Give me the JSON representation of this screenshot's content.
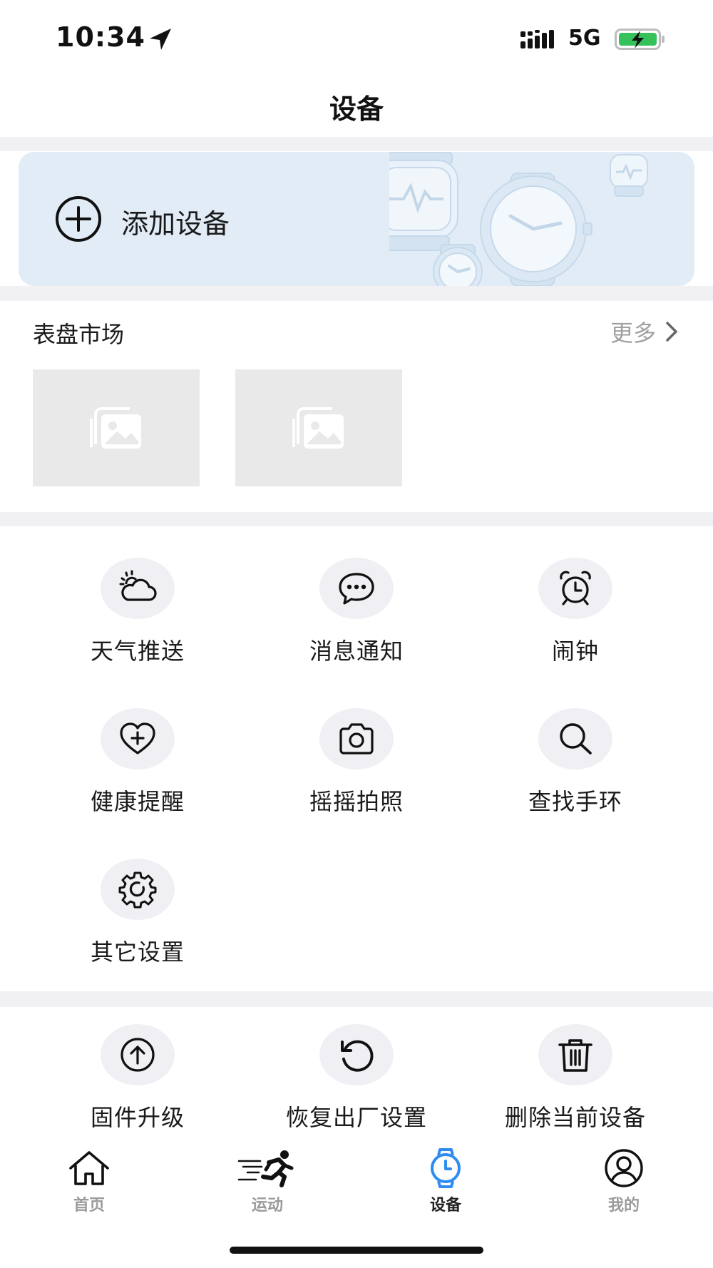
{
  "status_bar": {
    "time": "10:34",
    "network": "5G",
    "battery_color": "#36c25a"
  },
  "header": {
    "title": "设备"
  },
  "add_device": {
    "label": "添加设备",
    "icon": "plus-circle-icon",
    "card_color": "#e2ecf6"
  },
  "watch_market": {
    "title": "表盘市场",
    "more_label": "更多",
    "faces": [
      {
        "icon": "image-placeholder-icon"
      },
      {
        "icon": "image-placeholder-icon"
      }
    ]
  },
  "features": {
    "items": [
      {
        "label": "天气推送",
        "icon": "weather-icon"
      },
      {
        "label": "消息通知",
        "icon": "message-icon"
      },
      {
        "label": "闹钟",
        "icon": "alarm-clock-icon"
      },
      {
        "label": "健康提醒",
        "icon": "heart-plus-icon"
      },
      {
        "label": "摇摇拍照",
        "icon": "camera-icon"
      },
      {
        "label": "查找手环",
        "icon": "search-icon"
      },
      {
        "label": "其它设置",
        "icon": "gear-icon"
      }
    ]
  },
  "device_actions": {
    "items": [
      {
        "label": "固件升级",
        "icon": "upload-circle-icon"
      },
      {
        "label": "恢复出厂设置",
        "icon": "reset-icon"
      },
      {
        "label": "删除当前设备",
        "icon": "trash-icon"
      }
    ]
  },
  "tab_bar": {
    "tabs": [
      {
        "label": "首页",
        "icon": "home-icon"
      },
      {
        "label": "运动",
        "icon": "runner-icon"
      },
      {
        "label": "设备",
        "icon": "watch-icon",
        "active": true
      },
      {
        "label": "我的",
        "icon": "user-icon"
      }
    ],
    "active_color": "#2f8cf0"
  }
}
